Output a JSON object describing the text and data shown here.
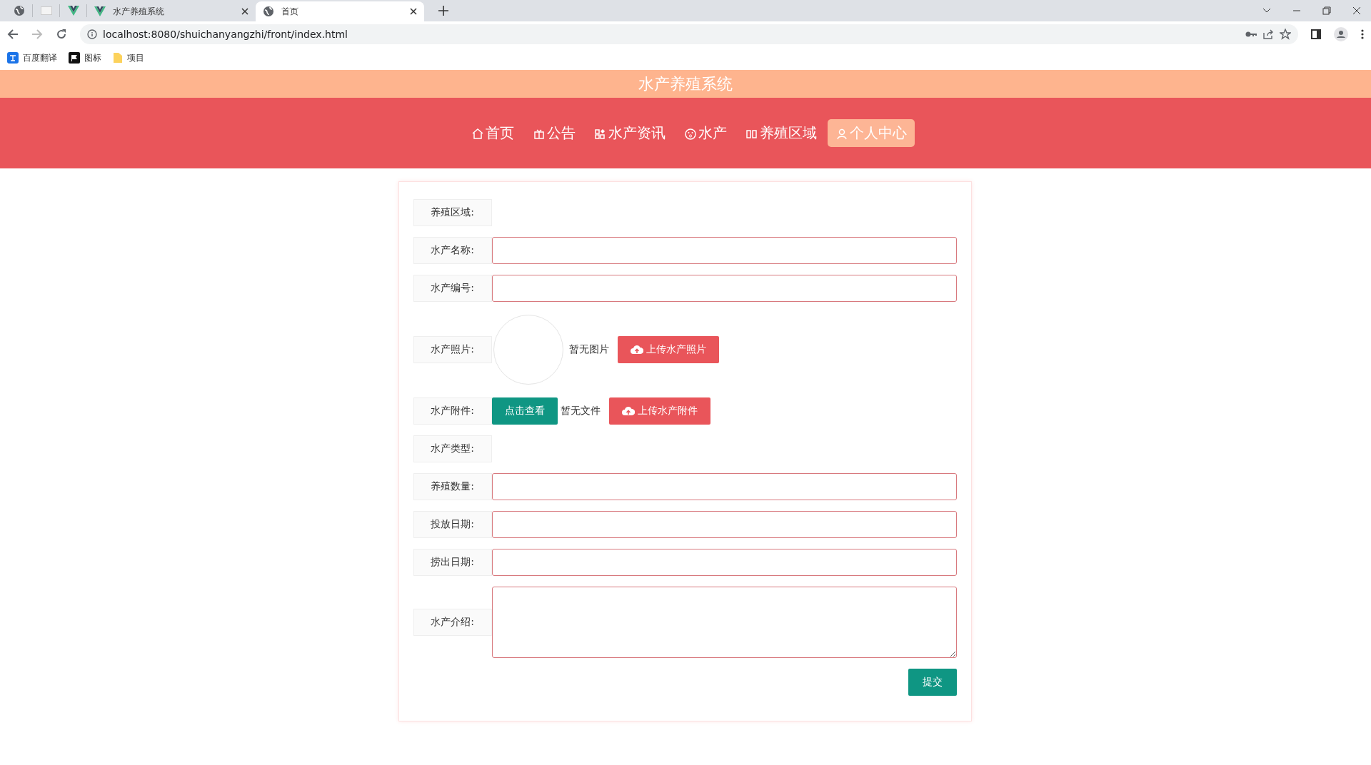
{
  "browser": {
    "tabs": [
      {
        "title": "水产养殖系统",
        "selected": false
      },
      {
        "title": "首页",
        "selected": true
      }
    ],
    "url": "localhost:8080/shuichanyangzhi/front/index.html",
    "bookmarks": [
      "百度翻译",
      "图标",
      "项目"
    ]
  },
  "site_title": "水产养殖系统",
  "nav": [
    {
      "label": "首页",
      "selected": false
    },
    {
      "label": "公告",
      "selected": false
    },
    {
      "label": "水产资讯",
      "selected": false
    },
    {
      "label": "水产",
      "selected": false
    },
    {
      "label": "养殖区域",
      "selected": false
    },
    {
      "label": "个人中心",
      "selected": true
    }
  ],
  "form": {
    "fields": [
      {
        "kind": "plain",
        "label": "养殖区域:"
      },
      {
        "kind": "input",
        "label": "水产名称:"
      },
      {
        "kind": "input",
        "label": "水产编号:"
      },
      {
        "kind": "photo",
        "label": "水产照片:",
        "status": "暂无图片",
        "upload": "上传水产照片"
      },
      {
        "kind": "file",
        "label": "水产附件:",
        "view": "点击查看",
        "status": "暂无文件",
        "upload": "上传水产附件"
      },
      {
        "kind": "plain",
        "label": "水产类型:"
      },
      {
        "kind": "input",
        "label": "养殖数量:"
      },
      {
        "kind": "input",
        "label": "投放日期:"
      },
      {
        "kind": "input",
        "label": "捞出日期:"
      },
      {
        "kind": "textarea",
        "label": "水产介绍:"
      }
    ],
    "submit": "提交"
  }
}
